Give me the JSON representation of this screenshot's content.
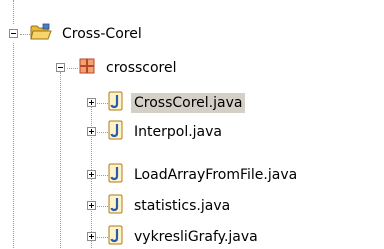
{
  "project": {
    "name": "Cross-Corel",
    "icon": "project-folder-icon",
    "expanded": true
  },
  "package": {
    "name": "crosscorel",
    "icon": "package-icon",
    "expanded": true
  },
  "files": [
    {
      "name": "CrossCorel.java",
      "icon": "java-file-icon",
      "selected": true
    },
    {
      "name": "Interpol.java",
      "icon": "java-file-icon",
      "selected": false
    },
    {
      "name": "LoadArrayFromFile.java",
      "icon": "java-file-icon",
      "selected": false
    },
    {
      "name": "statistics.java",
      "icon": "java-file-icon",
      "selected": false
    },
    {
      "name": "vykresliGrafy.java",
      "icon": "java-file-icon",
      "selected": false
    }
  ],
  "colors": {
    "selection": "#d4d0c8",
    "java_icon": "#e0a020",
    "folder": "#f3c646",
    "package": "#c0504d"
  }
}
